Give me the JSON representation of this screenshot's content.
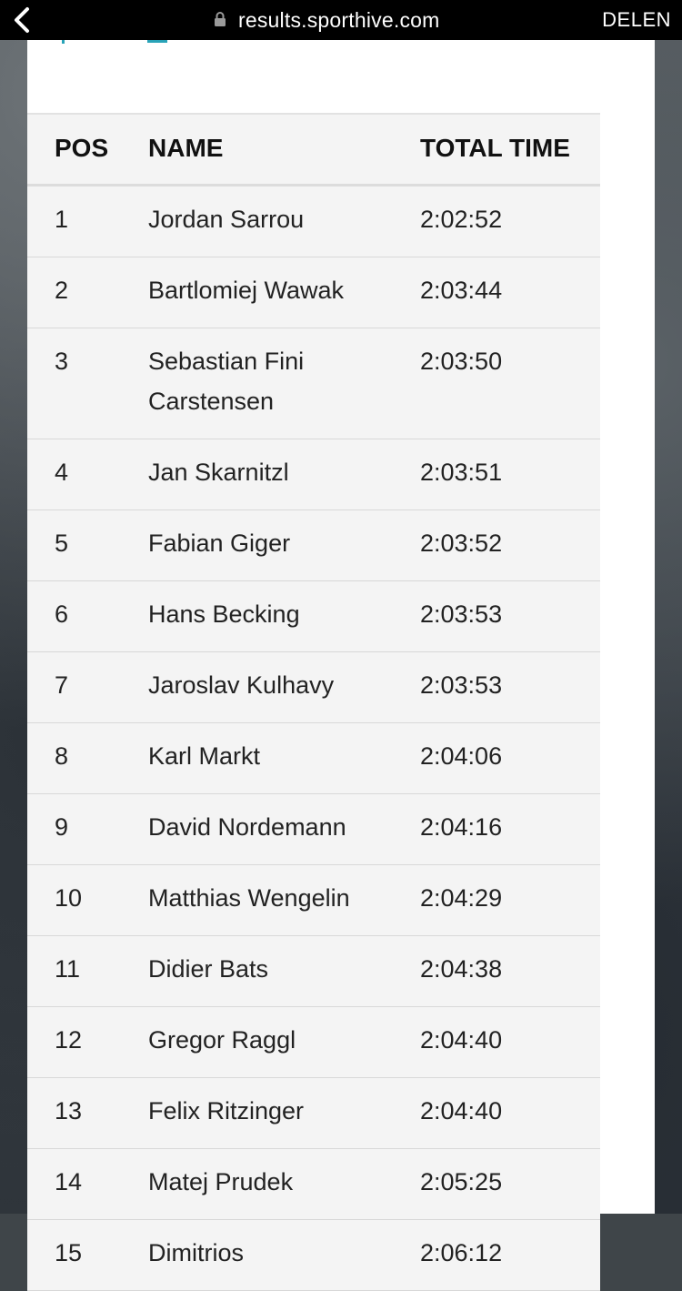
{
  "browser": {
    "url": "results.sporthive.com",
    "share_label": "DELEN"
  },
  "table": {
    "headers": {
      "pos": "POS",
      "name": "NAME",
      "time": "TOTAL TIME"
    },
    "rows": [
      {
        "pos": "1",
        "name": "Jordan Sarrou",
        "time": "2:02:52"
      },
      {
        "pos": "2",
        "name": "Bartlomiej Wawak",
        "time": "2:03:44"
      },
      {
        "pos": "3",
        "name": "Sebastian Fini Carstensen",
        "time": "2:03:50"
      },
      {
        "pos": "4",
        "name": "Jan Skarnitzl",
        "time": "2:03:51"
      },
      {
        "pos": "5",
        "name": "Fabian Giger",
        "time": "2:03:52"
      },
      {
        "pos": "6",
        "name": "Hans Becking",
        "time": "2:03:53"
      },
      {
        "pos": "7",
        "name": "Jaroslav Kulhavy",
        "time": "2:03:53"
      },
      {
        "pos": "8",
        "name": "Karl Markt",
        "time": "2:04:06"
      },
      {
        "pos": "9",
        "name": "David Nordemann",
        "time": "2:04:16"
      },
      {
        "pos": "10",
        "name": "Matthias Wengelin",
        "time": "2:04:29"
      },
      {
        "pos": "11",
        "name": "Didier Bats",
        "time": "2:04:38"
      },
      {
        "pos": "12",
        "name": "Gregor Raggl",
        "time": "2:04:40"
      },
      {
        "pos": "13",
        "name": "Felix Ritzinger",
        "time": "2:04:40"
      },
      {
        "pos": "14",
        "name": "Matej Prudek",
        "time": "2:05:25"
      },
      {
        "pos": "15",
        "name": "Dimitrios",
        "time": "2:06:12"
      }
    ]
  },
  "colors": {
    "accent": "#29a3b8",
    "table_bg": "#f4f4f4",
    "topbar_bg": "#000000"
  }
}
